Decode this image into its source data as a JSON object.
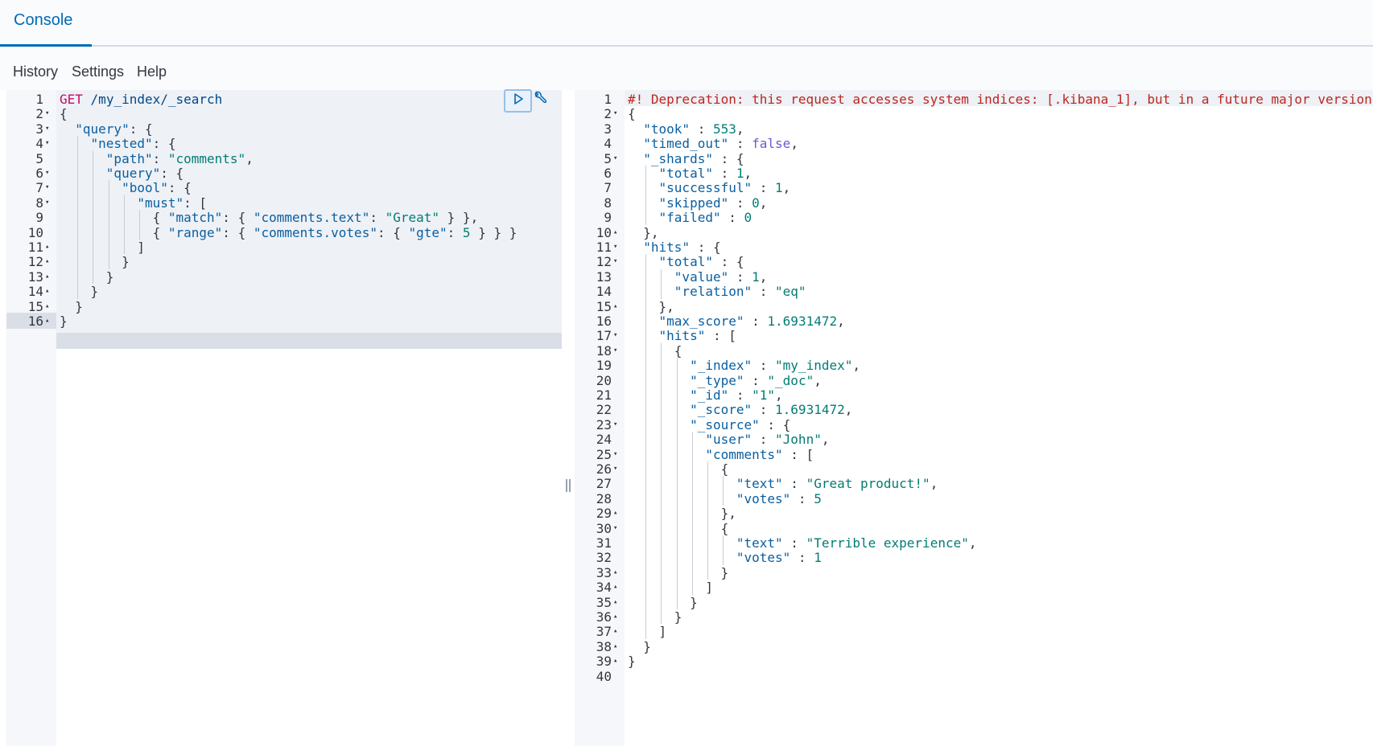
{
  "tabs": [
    {
      "label": "Console"
    }
  ],
  "menu": [
    {
      "label": "History"
    },
    {
      "label": "Settings"
    },
    {
      "label": "Help"
    }
  ],
  "request": {
    "verb": "GET",
    "url": "/my_index/_search",
    "lines": [
      "GET /my_index/_search",
      "{",
      "  \"query\": {",
      "    \"nested\": {",
      "      \"path\": \"comments\",",
      "      \"query\": {",
      "        \"bool\": {",
      "          \"must\": [",
      "            { \"match\": { \"comments.text\": \"Great\" } },",
      "            { \"range\": { \"comments.votes\": { \"gte\": 5 } } }",
      "          ]",
      "        }",
      "      }",
      "    }",
      "  }",
      "}"
    ]
  },
  "response": {
    "lines": [
      "#! Deprecation: this request accesses system indices: [.kibana_1], but in a future major version,",
      "{",
      "  \"took\" : 553,",
      "  \"timed_out\" : false,",
      "  \"_shards\" : {",
      "    \"total\" : 1,",
      "    \"successful\" : 1,",
      "    \"skipped\" : 0,",
      "    \"failed\" : 0",
      "  },",
      "  \"hits\" : {",
      "    \"total\" : {",
      "      \"value\" : 1,",
      "      \"relation\" : \"eq\"",
      "    },",
      "    \"max_score\" : 1.6931472,",
      "    \"hits\" : [",
      "      {",
      "        \"_index\" : \"my_index\",",
      "        \"_type\" : \"_doc\",",
      "        \"_id\" : \"1\",",
      "        \"_score\" : 1.6931472,",
      "        \"_source\" : {",
      "          \"user\" : \"John\",",
      "          \"comments\" : [",
      "            {",
      "              \"text\" : \"Great product!\",",
      "              \"votes\" : 5",
      "            },",
      "            {",
      "              \"text\" : \"Terrible experience\",",
      "              \"votes\" : 1",
      "            }",
      "          ]",
      "        }",
      "      }",
      "    ]",
      "  }",
      "}",
      ""
    ]
  },
  "icons": {
    "run": "play-icon",
    "settings": "wrench-icon"
  }
}
